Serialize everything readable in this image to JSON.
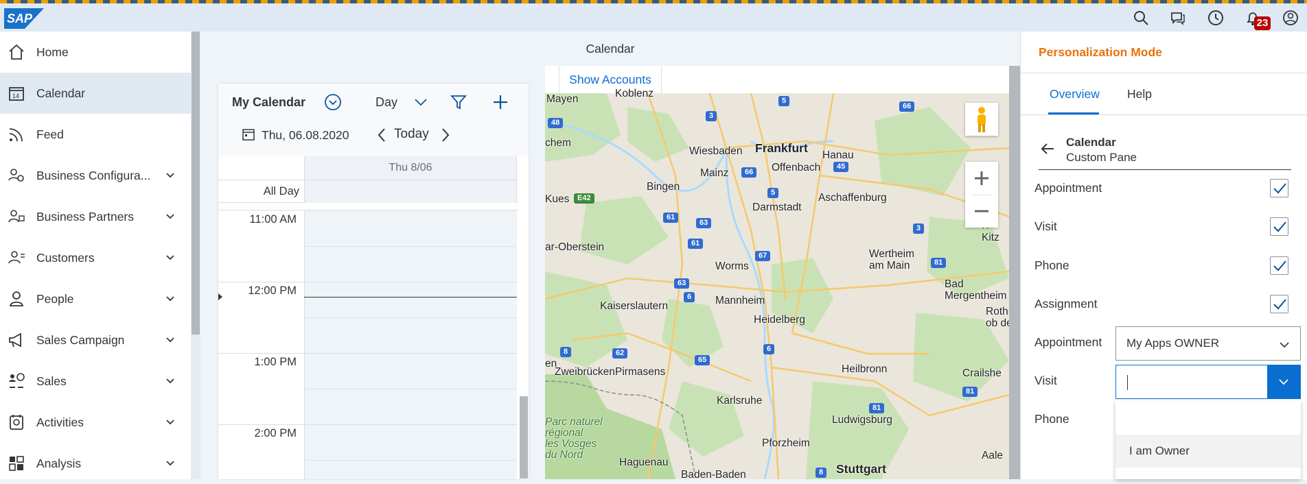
{
  "shell": {
    "logo_text": "SAP",
    "notification_count": "23",
    "icons": [
      "search-icon",
      "chat-icon",
      "clock-icon",
      "bell-icon",
      "user-icon"
    ]
  },
  "sidebar": {
    "items": [
      {
        "label": "Home",
        "icon": "home-icon",
        "expandable": false,
        "active": false
      },
      {
        "label": "Calendar",
        "icon": "calendar-icon",
        "expandable": false,
        "active": true
      },
      {
        "label": "Feed",
        "icon": "feed-icon",
        "expandable": false,
        "active": false
      },
      {
        "label": "Business Configura...",
        "icon": "business-config-icon",
        "expandable": true,
        "active": false
      },
      {
        "label": "Business Partners",
        "icon": "business-partners-icon",
        "expandable": true,
        "active": false
      },
      {
        "label": "Customers",
        "icon": "customers-icon",
        "expandable": true,
        "active": false
      },
      {
        "label": "People",
        "icon": "people-icon",
        "expandable": true,
        "active": false
      },
      {
        "label": "Sales Campaign",
        "icon": "campaign-icon",
        "expandable": true,
        "active": false
      },
      {
        "label": "Sales",
        "icon": "sales-icon",
        "expandable": true,
        "active": false
      },
      {
        "label": "Activities",
        "icon": "activities-icon",
        "expandable": true,
        "active": false
      },
      {
        "label": "Analysis",
        "icon": "analysis-icon",
        "expandable": true,
        "active": false
      }
    ]
  },
  "main": {
    "title": "Calendar",
    "calendar": {
      "title": "My Calendar",
      "view": "Day",
      "date": "Thu, 06.08.2020",
      "today_label": "Today",
      "column_header": "Thu 8/06",
      "all_day_label": "All Day",
      "hours": [
        "11:00 AM",
        "12:00 PM",
        "1:00 PM",
        "2:00 PM"
      ]
    },
    "map": {
      "show_accounts_label": "Show Accounts",
      "labels": {
        "frankfurt": "Frankfurt",
        "hanau": "Hanau",
        "offenbach": "Offenbach",
        "wiesbaden": "Wiesbaden",
        "mainz": "Mainz",
        "bingen": "Bingen",
        "darmstadt": "Darmstadt",
        "aschaffenburg": "Aschaffenburg",
        "kues": "Kues",
        "oberstein": "ar-Oberstein",
        "worms": "Worms",
        "wertheim": "Wertheim\nam Main",
        "mannheim": "Mannheim",
        "kaiserslautern": "Kaiserslautern",
        "heidelberg": "Heidelberg",
        "bad_mergentheim": "Bad\nMergentheim",
        "zweibruecken": "Zweibrücken",
        "pirmasens": "Pirmasens",
        "heilbronn": "Heilbronn",
        "karlsruhe": "Karlsruhe",
        "ludwigsburg": "Ludwigsburg",
        "pforzheim": "Pforzheim",
        "haguenau": "Haguenau",
        "baden_baden": "Baden-Baden",
        "stuttgart": "Stuttgart",
        "parc": "Parc naturel\nrégional\nles Vosges\ndu Nord",
        "mayen": "Mayen",
        "chem": "chem",
        "en": "en",
        "crails": "Crailshe",
        "aale": "Aale",
        "roth": "Roth\nob de",
        "kitz": "Kitz",
        "w": "W",
        "koblenz": "Koblenz"
      },
      "roads": [
        "3",
        "5",
        "66",
        "48",
        "66",
        "45",
        "E42",
        "61",
        "63",
        "61",
        "5",
        "3",
        "67",
        "63",
        "81",
        "6",
        "8",
        "62",
        "65",
        "6",
        "81",
        "81",
        "8"
      ]
    }
  },
  "pane": {
    "title": "Personalization Mode",
    "tabs": [
      "Overview",
      "Help"
    ],
    "back_title": "Calendar",
    "back_subtitle": "Custom Pane",
    "checkboxes": [
      {
        "label": "Appointment",
        "checked": true
      },
      {
        "label": "Visit",
        "checked": true
      },
      {
        "label": "Phone",
        "checked": true
      },
      {
        "label": "Assignment",
        "checked": true
      }
    ],
    "selects": {
      "appointment": {
        "label": "Appointment",
        "value": "My Apps OWNER"
      },
      "visit": {
        "label": "Visit",
        "value": ""
      },
      "phone": {
        "label": "Phone"
      }
    },
    "dropdown_options": [
      "",
      "I am Owner"
    ],
    "colors": {
      "accent": "#0a6ed1",
      "title": "#e9730c",
      "badge": "#bb0000"
    }
  }
}
